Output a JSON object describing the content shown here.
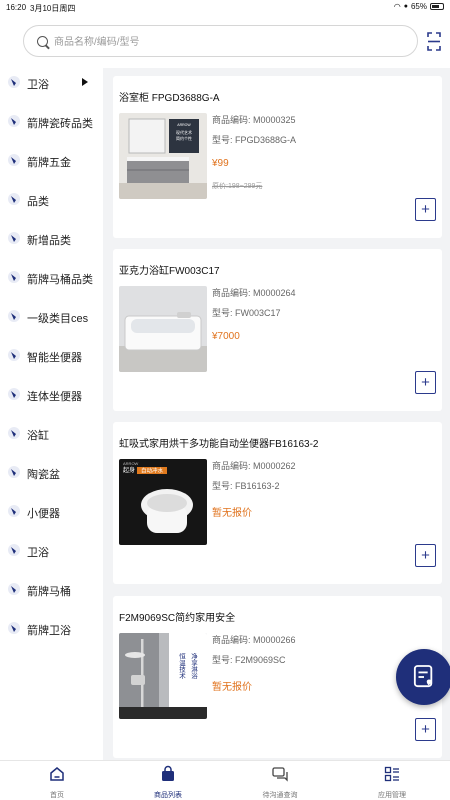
{
  "status_bar": {
    "time": "16:20",
    "date": "3月10日周四",
    "battery": "65%"
  },
  "search": {
    "placeholder": "商品名称/编码/型号"
  },
  "sidebar": {
    "items": [
      {
        "label": "卫浴",
        "selected": true
      },
      {
        "label": "箭牌瓷砖品类"
      },
      {
        "label": "箭牌五金"
      },
      {
        "label": "品类"
      },
      {
        "label": "新增品类"
      },
      {
        "label": "箭牌马桶品类"
      },
      {
        "label": "一级类目ces"
      },
      {
        "label": "智能坐便器"
      },
      {
        "label": "连体坐便器"
      },
      {
        "label": "浴缸"
      },
      {
        "label": "陶瓷盆"
      },
      {
        "label": "小便器"
      },
      {
        "label": "卫浴"
      },
      {
        "label": "箭牌马桶"
      },
      {
        "label": "箭牌卫浴"
      }
    ]
  },
  "products": [
    {
      "title": "浴室柜 FPGD3688G-A",
      "code": "商品编码: M0000325",
      "model": "型号: FPGD3688G-A",
      "price": "¥99",
      "old_price": "原价:198~299元"
    },
    {
      "title": "亚克力浴缸FW003C17",
      "code": "商品编码: M0000264",
      "model": "型号: FW003C17",
      "price": "¥7000"
    },
    {
      "title": "虹吸式家用烘干多功能自动坐便器FB16163-2",
      "code": "商品编码: M0000262",
      "model": "型号: FB16163-2",
      "price": "暂无报价",
      "image_text": {
        "line1": "起身",
        "line2": "自动冲水",
        "brand": "ARROW"
      }
    },
    {
      "title": "F2M9069SC简约家用安全",
      "code": "商品编码: M0000266",
      "model": "型号: F2M9069SC",
      "price": "暂无报价",
      "image_text": {
        "v1": "恒温技术",
        "v2": "净享淋浴"
      }
    }
  ],
  "product1_image": {
    "panel_lines": [
      "ARROW",
      "现代艺术",
      "简约个性"
    ]
  },
  "tabbar": {
    "items": [
      {
        "label": "首页"
      },
      {
        "label": "商品列表",
        "active": true
      },
      {
        "label": "待沟通查询"
      },
      {
        "label": "应用管理"
      }
    ]
  },
  "colors": {
    "accent": "#1f2f7a",
    "price": "#e0731e"
  }
}
